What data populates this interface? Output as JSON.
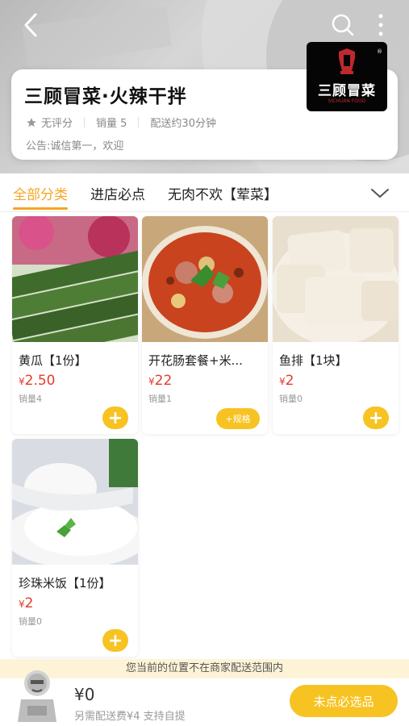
{
  "store": {
    "name": "三顾冒菜·火辣干拌",
    "rating": "无评分",
    "sales": "销量 5",
    "delivery_time": "配送约30分钟",
    "notice": "公告:诚信第一，欢迎",
    "logo_text": "三顾冒菜",
    "logo_subtext": "SICHUAN FOOD",
    "logo_mark": "®"
  },
  "tabs": [
    {
      "label": "全部分类"
    },
    {
      "label": "进店必点"
    },
    {
      "label": "无肉不欢【荤菜】"
    }
  ],
  "products": [
    {
      "name": "黄瓜【1份】",
      "currency": "¥",
      "price": "2.50",
      "sales": "销量4",
      "action": "+"
    },
    {
      "name": "开花肠套餐+米...",
      "currency": "¥",
      "price": "22",
      "sales": "销量1",
      "action": "+规格"
    },
    {
      "name": "鱼排【1块】",
      "currency": "¥",
      "price": "2",
      "sales": "销量0",
      "action": "+"
    },
    {
      "name": "珍珠米饭【1份】",
      "currency": "¥",
      "price": "2",
      "sales": "销量0",
      "action": "+"
    }
  ],
  "delivery_notice": "您当前的位置不在商家配送范围内",
  "cart": {
    "total": "¥0",
    "delivery_info": "另需配送费¥4  支持自提",
    "checkout_label": "未点必选品"
  },
  "colors": {
    "accent": "#f5a623",
    "button": "#f7c322",
    "price": "#e43a2b"
  },
  "icons": [
    "back-icon",
    "search-icon",
    "more-icon",
    "star-icon",
    "chevron-down-icon",
    "plus-icon",
    "cart-icon"
  ]
}
